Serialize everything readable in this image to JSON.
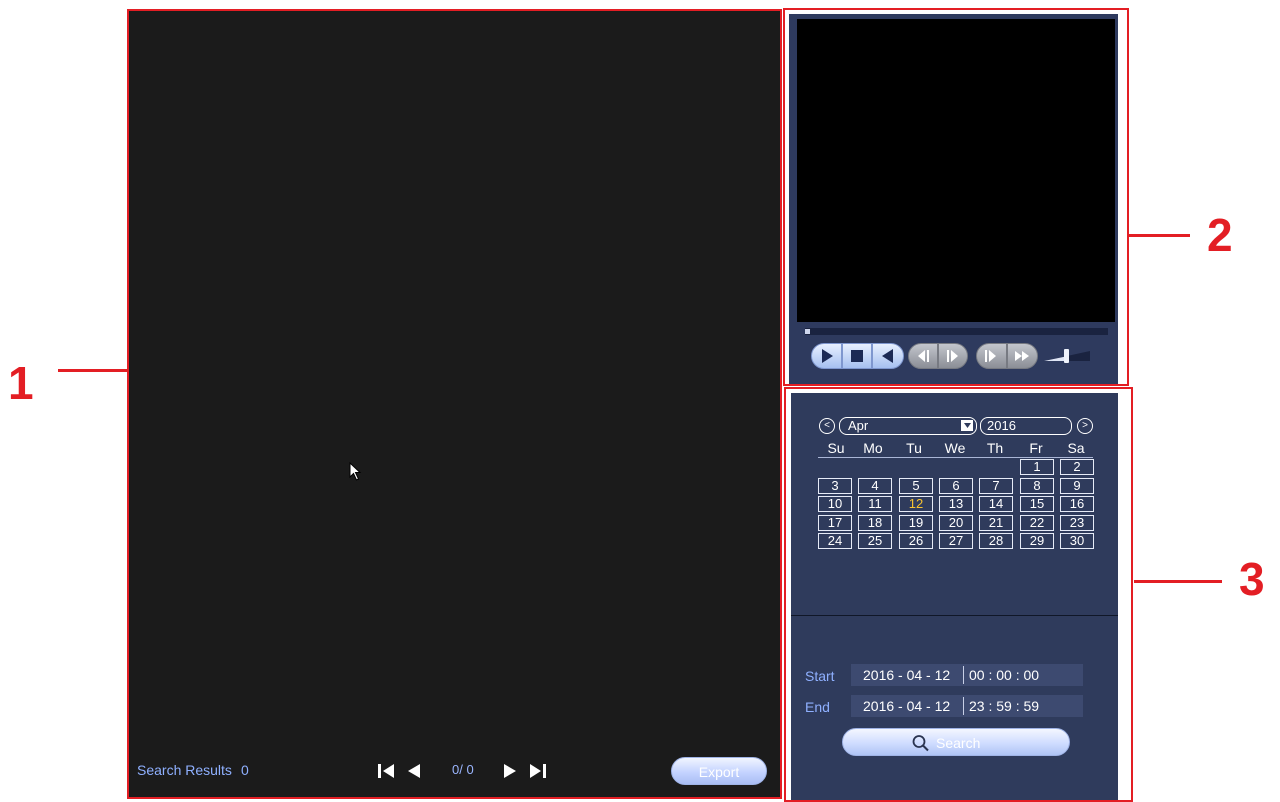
{
  "results_panel": {
    "search_results_label": "Search Results",
    "search_results_count": "0",
    "page_indicator": "0/ 0",
    "export_label": "Export"
  },
  "player": {
    "controls": [
      "play-icon",
      "stop-icon",
      "reverse-play-icon",
      "prev-frame-icon",
      "next-frame-icon",
      "slow-play-icon",
      "fast-forward-icon",
      "volume-icon"
    ]
  },
  "calendar": {
    "month": "Apr",
    "year": "2016",
    "prev_label": "<",
    "next_label": ">",
    "weekdays": [
      "Su",
      "Mo",
      "Tu",
      "We",
      "Th",
      "Fr",
      "Sa"
    ],
    "selected_day": "12",
    "weeks": [
      [
        "",
        "",
        "",
        "",
        "",
        "1",
        "2"
      ],
      [
        "3",
        "4",
        "5",
        "6",
        "7",
        "8",
        "9"
      ],
      [
        "10",
        "11",
        "12",
        "13",
        "14",
        "15",
        "16"
      ],
      [
        "17",
        "18",
        "19",
        "20",
        "21",
        "22",
        "23"
      ],
      [
        "24",
        "25",
        "26",
        "27",
        "28",
        "29",
        "30"
      ]
    ]
  },
  "search": {
    "start_label": "Start",
    "start_date": "2016 - 04 - 12",
    "start_time": "00 : 00 : 00",
    "end_label": "End",
    "end_date": "2016 - 04 - 12",
    "end_time": "23 : 59 : 59",
    "button_label": "Search"
  },
  "callouts": {
    "one": "1",
    "two": "2",
    "three": "3"
  },
  "colors": {
    "callout_red": "#e31e24",
    "panel_navy": "#2f3b5c",
    "label_blue": "#8fb0ff",
    "today_yellow": "#f7c330"
  }
}
